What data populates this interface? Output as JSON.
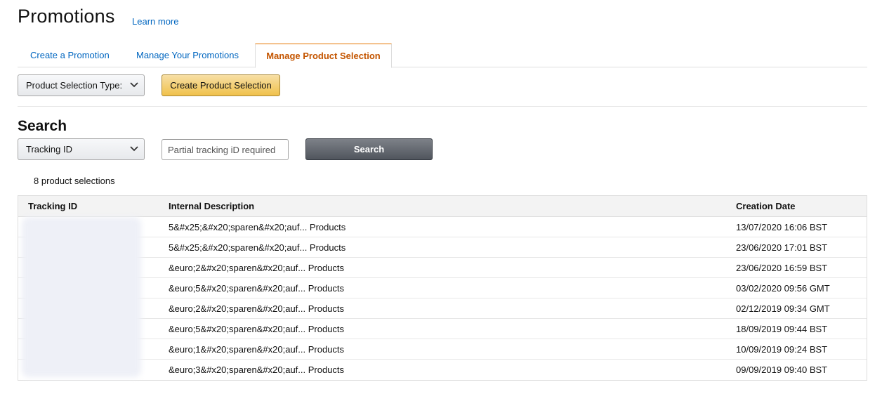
{
  "header": {
    "title": "Promotions",
    "learn_more": "Learn more"
  },
  "tabs": [
    {
      "label": "Create a Promotion",
      "active": false
    },
    {
      "label": "Manage Your Promotions",
      "active": false
    },
    {
      "label": "Manage Product Selection",
      "active": true
    }
  ],
  "toolbar": {
    "selection_type_label": "Product Selection Type:",
    "create_button": "Create Product Selection"
  },
  "search": {
    "heading": "Search",
    "field_selected": "Tracking ID",
    "input_value": "",
    "input_placeholder": "Partial tracking iD required",
    "button": "Search"
  },
  "results": {
    "count_text": "8 product selections",
    "columns": [
      "Tracking ID",
      "Internal Description",
      "Creation Date"
    ],
    "rows": [
      {
        "tracking_id": "",
        "description": "5&#x25;&#x20;sparen&#x20;auf... Products",
        "date": "13/07/2020 16:06 BST"
      },
      {
        "tracking_id": "",
        "description": "5&#x25;&#x20;sparen&#x20;auf... Products",
        "date": "23/06/2020 17:01 BST"
      },
      {
        "tracking_id": "",
        "description": "&euro;2&#x20;sparen&#x20;auf... Products",
        "date": "23/06/2020 16:59 BST"
      },
      {
        "tracking_id": "",
        "description": "&euro;5&#x20;sparen&#x20;auf... Products",
        "date": "03/02/2020 09:56 GMT"
      },
      {
        "tracking_id": "",
        "description": "&euro;2&#x20;sparen&#x20;auf... Products",
        "date": "02/12/2019 09:34 GMT"
      },
      {
        "tracking_id": "",
        "description": "&euro;5&#x20;sparen&#x20;auf... Products",
        "date": "18/09/2019 09:44 BST"
      },
      {
        "tracking_id": "",
        "description": "&euro;1&#x20;sparen&#x20;auf... Products",
        "date": "10/09/2019 09:24 BST"
      },
      {
        "tracking_id": "",
        "description": "&euro;3&#x20;sparen&#x20;auf... Products",
        "date": "09/09/2019 09:40 BST"
      }
    ]
  },
  "colors": {
    "link": "#0066c0",
    "active_tab": "#c45500",
    "primary_button": "#f0c14b",
    "search_button": "#50555d"
  }
}
